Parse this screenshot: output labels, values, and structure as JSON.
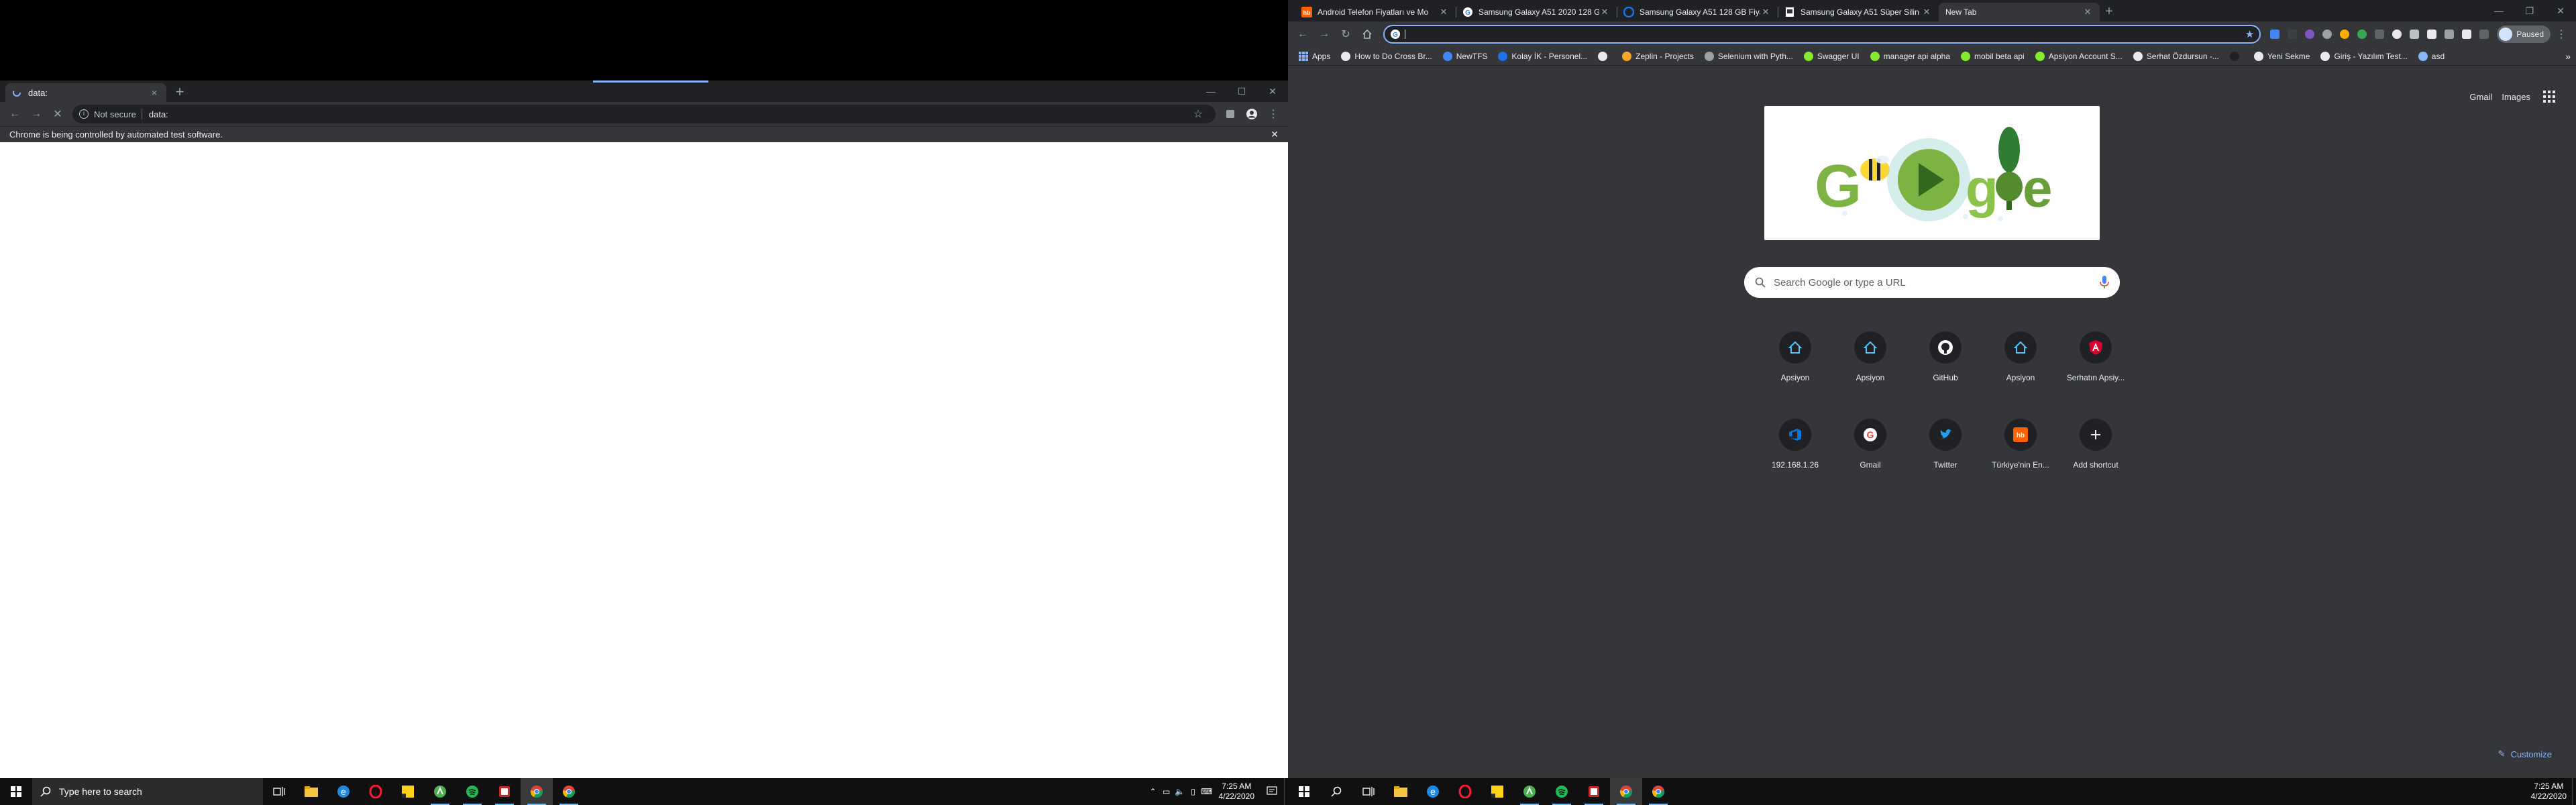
{
  "left": {
    "tab": {
      "title": "data:",
      "close": "×"
    },
    "new_tab": "+",
    "toolbar": {
      "not_secure": "Not secure",
      "url": "data:"
    },
    "infobar": {
      "message": "Chrome is being controlled by automated test software.",
      "close": "✕"
    }
  },
  "taskbar_left": {
    "search_placeholder": "Type here to search",
    "time": "7:25 AM",
    "date": "4/22/2020"
  },
  "right": {
    "tabs": [
      {
        "title": "Android Telefon Fiyatları ve Mo",
        "favicon": "hepsiburada-icon",
        "color": "#ff6000"
      },
      {
        "title": "Samsung Galaxy A51 2020 128 G",
        "favicon": "google-icon",
        "color": "#ffffff"
      },
      {
        "title": "Samsung Galaxy A51 128 GB Fiya",
        "favicon": "cimri-icon",
        "color": "#1a73e8"
      },
      {
        "title": "Samsung Galaxy A51 Süper Silin",
        "favicon": "page-icon",
        "color": "#ffffff"
      },
      {
        "title": "New Tab",
        "favicon": "",
        "color": ""
      }
    ],
    "new_tab": "+",
    "profile_label": "Paused",
    "bookmarks": [
      {
        "label": "Apps",
        "color": "#8ab4f8"
      },
      {
        "label": "How to Do Cross Br...",
        "color": "#e8eaed"
      },
      {
        "label": "NewTFS",
        "color": "#4285f4"
      },
      {
        "label": "Kolay İK - Personel...",
        "color": "#1a73e8"
      },
      {
        "label": "",
        "color": "#e8eaed"
      },
      {
        "label": "Zeplin - Projects",
        "color": "#f9a825"
      },
      {
        "label": "Selenium with Pyth...",
        "color": "#9aa0a6"
      },
      {
        "label": "Swagger UI",
        "color": "#85ea2d"
      },
      {
        "label": "manager api alpha",
        "color": "#85ea2d"
      },
      {
        "label": "mobil beta api",
        "color": "#85ea2d"
      },
      {
        "label": "Apsiyon Account S...",
        "color": "#85ea2d"
      },
      {
        "label": "Serhat Özdursun -...",
        "color": "#e8eaed"
      },
      {
        "label": "",
        "color": "#202124"
      },
      {
        "label": "Yeni Sekme",
        "color": "#e8eaed"
      },
      {
        "label": "Giriş - Yazılım Test...",
        "color": "#e8eaed"
      },
      {
        "label": "asd",
        "color": "#8ab4f8"
      }
    ],
    "bookmarks_more": "»",
    "ntp": {
      "gmail": "Gmail",
      "images": "Images",
      "search_placeholder": "Search Google or type a URL",
      "shortcuts": [
        {
          "label": "Apsiyon",
          "icon": "apsiyon-icon"
        },
        {
          "label": "Apsiyon",
          "icon": "apsiyon-icon"
        },
        {
          "label": "GitHub",
          "icon": "github-icon"
        },
        {
          "label": "Apsiyon",
          "icon": "apsiyon-icon"
        },
        {
          "label": "Serhatın Apsiy...",
          "icon": "angular-icon"
        },
        {
          "label": "192.168.1.26",
          "icon": "azure-devops-icon"
        },
        {
          "label": "Gmail",
          "icon": "google-icon"
        },
        {
          "label": "Twitter",
          "icon": "twitter-icon"
        },
        {
          "label": "Türkiye'nin En...",
          "icon": "hepsiburada-icon"
        },
        {
          "label": "Add shortcut",
          "icon": "plus-icon"
        }
      ],
      "customize": "Customize"
    }
  },
  "taskbar_right": {
    "time": "7:25 AM",
    "date": "4/22/2020"
  },
  "colors": {
    "chrome_dark": "#35363a",
    "chrome_darker": "#202124",
    "accent_blue": "#8ab4f8",
    "taskbar": "#101010"
  }
}
